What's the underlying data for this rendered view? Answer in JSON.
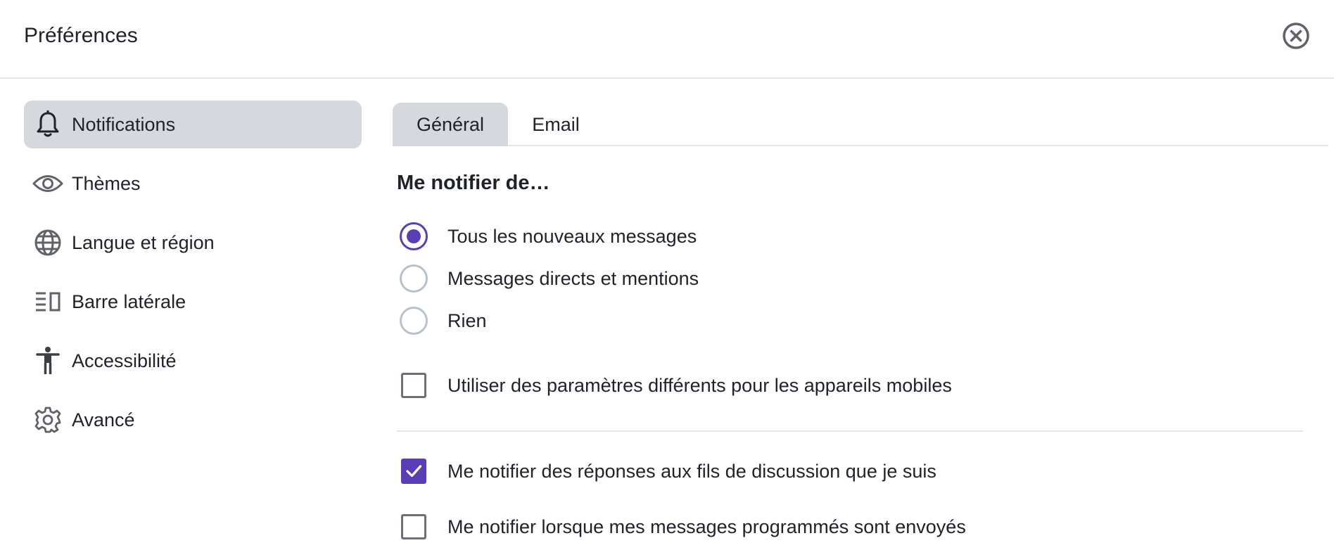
{
  "header": {
    "title": "Préférences",
    "close_icon": "close-circle-icon"
  },
  "sidebar": {
    "items": [
      {
        "label": "Notifications",
        "icon": "bell-icon",
        "active": true
      },
      {
        "label": "Thèmes",
        "icon": "eye-icon",
        "active": false
      },
      {
        "label": "Langue et région",
        "icon": "globe-icon",
        "active": false
      },
      {
        "label": "Barre latérale",
        "icon": "sidebar-icon",
        "active": false
      },
      {
        "label": "Accessibilité",
        "icon": "accessibility-icon",
        "active": false
      },
      {
        "label": "Avancé",
        "icon": "gear-icon",
        "active": false
      }
    ]
  },
  "tabs": [
    {
      "label": "Général",
      "active": true
    },
    {
      "label": "Email",
      "active": false
    }
  ],
  "notify": {
    "section_title": "Me notifier de…",
    "options": [
      {
        "label": "Tous les nouveaux messages",
        "selected": true
      },
      {
        "label": "Messages directs et mentions",
        "selected": false
      },
      {
        "label": "Rien",
        "selected": false
      }
    ],
    "mobile_checkbox": {
      "label": "Utiliser des paramètres différents pour les appareils mobiles",
      "checked": false
    },
    "threads_checkbox": {
      "label": "Me notifier des réponses aux fils de discussion que je suis",
      "checked": true
    },
    "scheduled_checkbox": {
      "label": "Me notifier lorsque mes messages programmés sont envoyés",
      "checked": false
    }
  },
  "colors": {
    "accent": "#5a3eb8",
    "active_bg": "#d5d9dd",
    "divider": "#e4e6ea"
  }
}
